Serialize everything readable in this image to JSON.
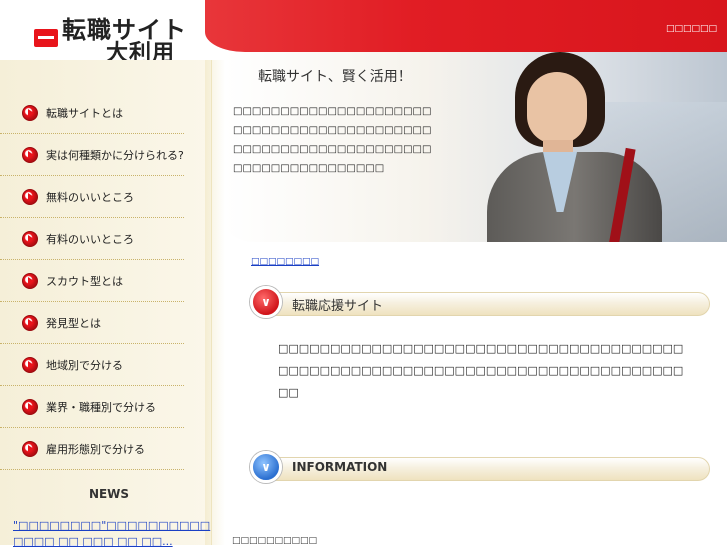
{
  "header": {
    "logo_line1": "転職サイト",
    "logo_line2": "大利用",
    "top_link": "□□□□□□"
  },
  "sidebar": {
    "items": [
      {
        "label": "転職サイトとは"
      },
      {
        "label": "実は何種類かに分けられる?"
      },
      {
        "label": "無料のいいところ"
      },
      {
        "label": "有料のいいところ"
      },
      {
        "label": "スカウト型とは"
      },
      {
        "label": "発見型とは"
      },
      {
        "label": "地域別で分ける"
      },
      {
        "label": "業界・職種別で分ける"
      },
      {
        "label": "雇用形態別で分ける"
      }
    ],
    "news_title": "NEWS",
    "news_link": "\"□□□□□□□□\"□□□□□□□□□□□□□□ □□ □□□ □□ □□..."
  },
  "hero": {
    "title": "転職サイト、賢く活用！",
    "text": "□□□□□□□□□□□□□□□□□□□□□□□□□□□□□□□□□□□□□□□□□□□□□□□□□□□□□□□□□□□□□□□□□□□□□□□□□□□□□□□"
  },
  "main": {
    "breadcrumb": "□□□□□□□□",
    "section1_title": "転職応援サイト",
    "section1_text": "□□□□□□□□□□□□□□□□□□□□□□□□□□□□□□□□□□□□□□□□□□□□□□□□□□□□□□□□□□□□□□□□□□□□□□□□□□□□□□□□",
    "section2_title": "INFORMATION",
    "footer_text": "□□□□□□□□□□"
  }
}
